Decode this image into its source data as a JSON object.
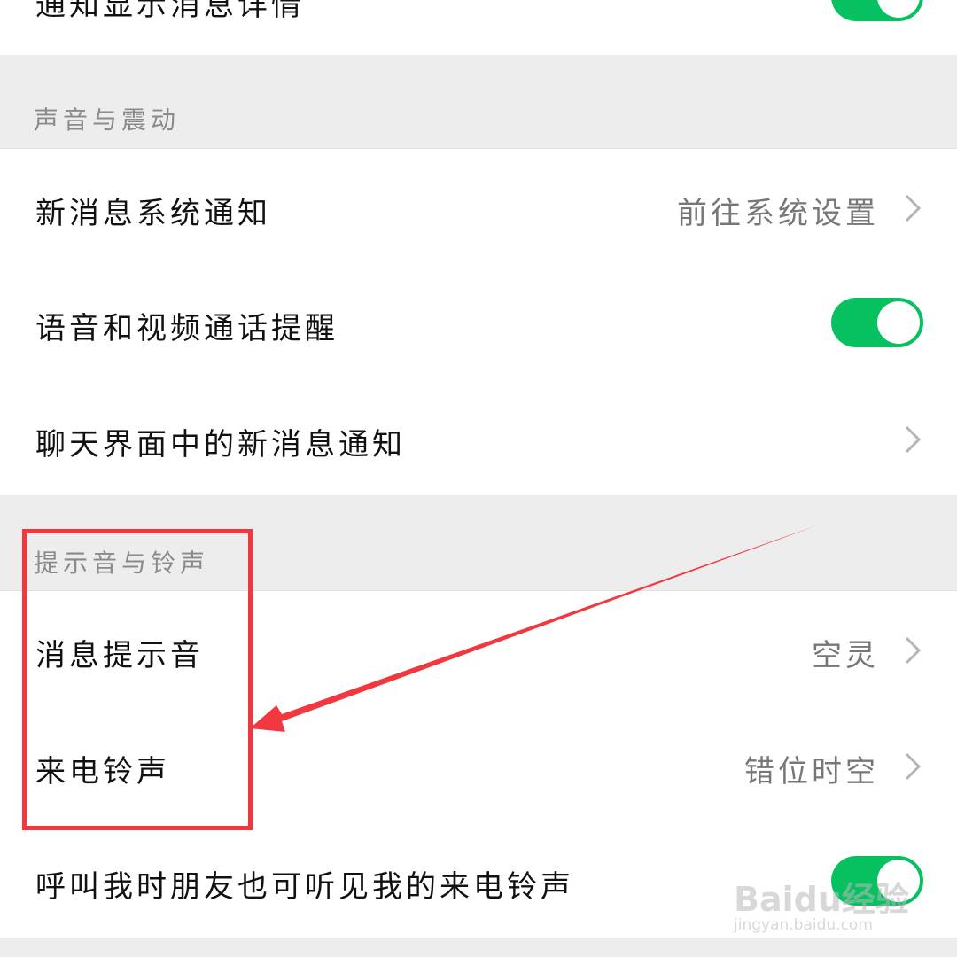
{
  "top_row": {
    "label": "通知显示消息详情",
    "toggle_on": true
  },
  "section_sound": {
    "title": "声音与震动"
  },
  "row_system_notify": {
    "label": "新消息系统通知",
    "value": "前往系统设置"
  },
  "row_call_alert": {
    "label": "语音和视频通话提醒",
    "toggle_on": true
  },
  "row_chat_notify": {
    "label": "聊天界面中的新消息通知"
  },
  "section_tones": {
    "title": "提示音与铃声"
  },
  "row_msg_tone": {
    "label": "消息提示音",
    "value": "空灵"
  },
  "row_ringtone": {
    "label": "来电铃声",
    "value": "错位时空"
  },
  "row_friend_hear": {
    "label": "呼叫我时朋友也可听见我的来电铃声",
    "toggle_on": true
  },
  "watermark": {
    "brand": "Baidu经验",
    "url": "jingyan.baidu.com"
  },
  "colors": {
    "toggle_on": "#07c160",
    "annotation": "#f0383e",
    "background": "#ededed"
  }
}
